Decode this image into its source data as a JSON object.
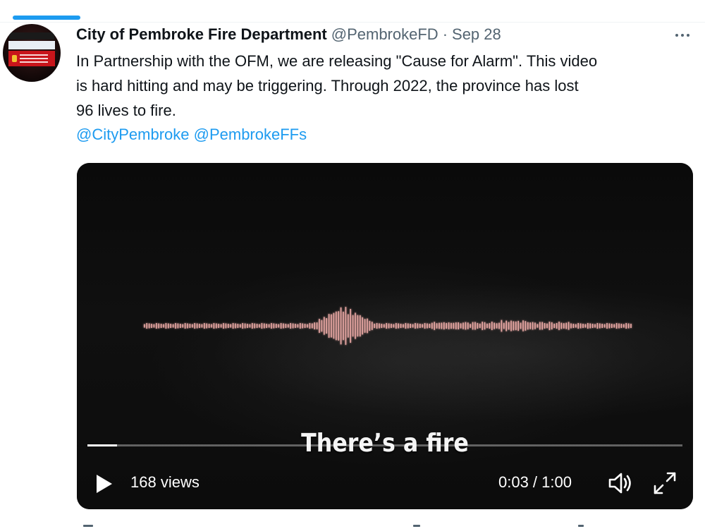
{
  "tweet": {
    "author_name": "City of Pembroke Fire Department",
    "handle": "@PembrokeFD",
    "separator": "·",
    "date": "Sep 28",
    "text": "In Partnership with the OFM, we are releasing \"Cause for Alarm\". This video\nis hard hitting and may be triggering. Through 2022, the province has lost\n96 lives to fire.",
    "mentions": [
      "@CityPembroke",
      "@PembrokeFFs"
    ]
  },
  "video": {
    "caption": "There’s a fire",
    "views": "168 views",
    "time": "0:03 / 1:00",
    "progress": 0.05
  },
  "colors": {
    "accent": "#1d9bf0",
    "text": "#0f1419",
    "secondary": "#536471",
    "waveform": "#e9a8a4"
  },
  "icons": {
    "more": "more-horizontal-icon",
    "play": "play-icon",
    "volume": "volume-icon",
    "fullscreen": "fullscreen-icon"
  }
}
